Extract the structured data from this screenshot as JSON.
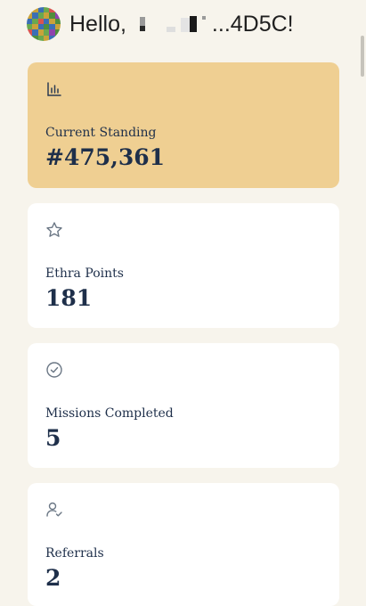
{
  "header": {
    "greeting_prefix": "Hello,",
    "address_suffix": "...4D5C!"
  },
  "cards": [
    {
      "icon": "bar-chart-icon",
      "label": "Current Standing",
      "value": "#475,361",
      "highlight": true
    },
    {
      "icon": "star-icon",
      "label": "Ethra Points",
      "value": "181",
      "highlight": false
    },
    {
      "icon": "check-circle-icon",
      "label": "Missions Completed",
      "value": "5",
      "highlight": false
    },
    {
      "icon": "user-check-icon",
      "label": "Referrals",
      "value": "2",
      "highlight": false
    }
  ],
  "colors": {
    "background": "#f7f4ec",
    "highlight_card": "#efcf92",
    "card": "#ffffff",
    "text_dark": "#1e2f4a"
  }
}
